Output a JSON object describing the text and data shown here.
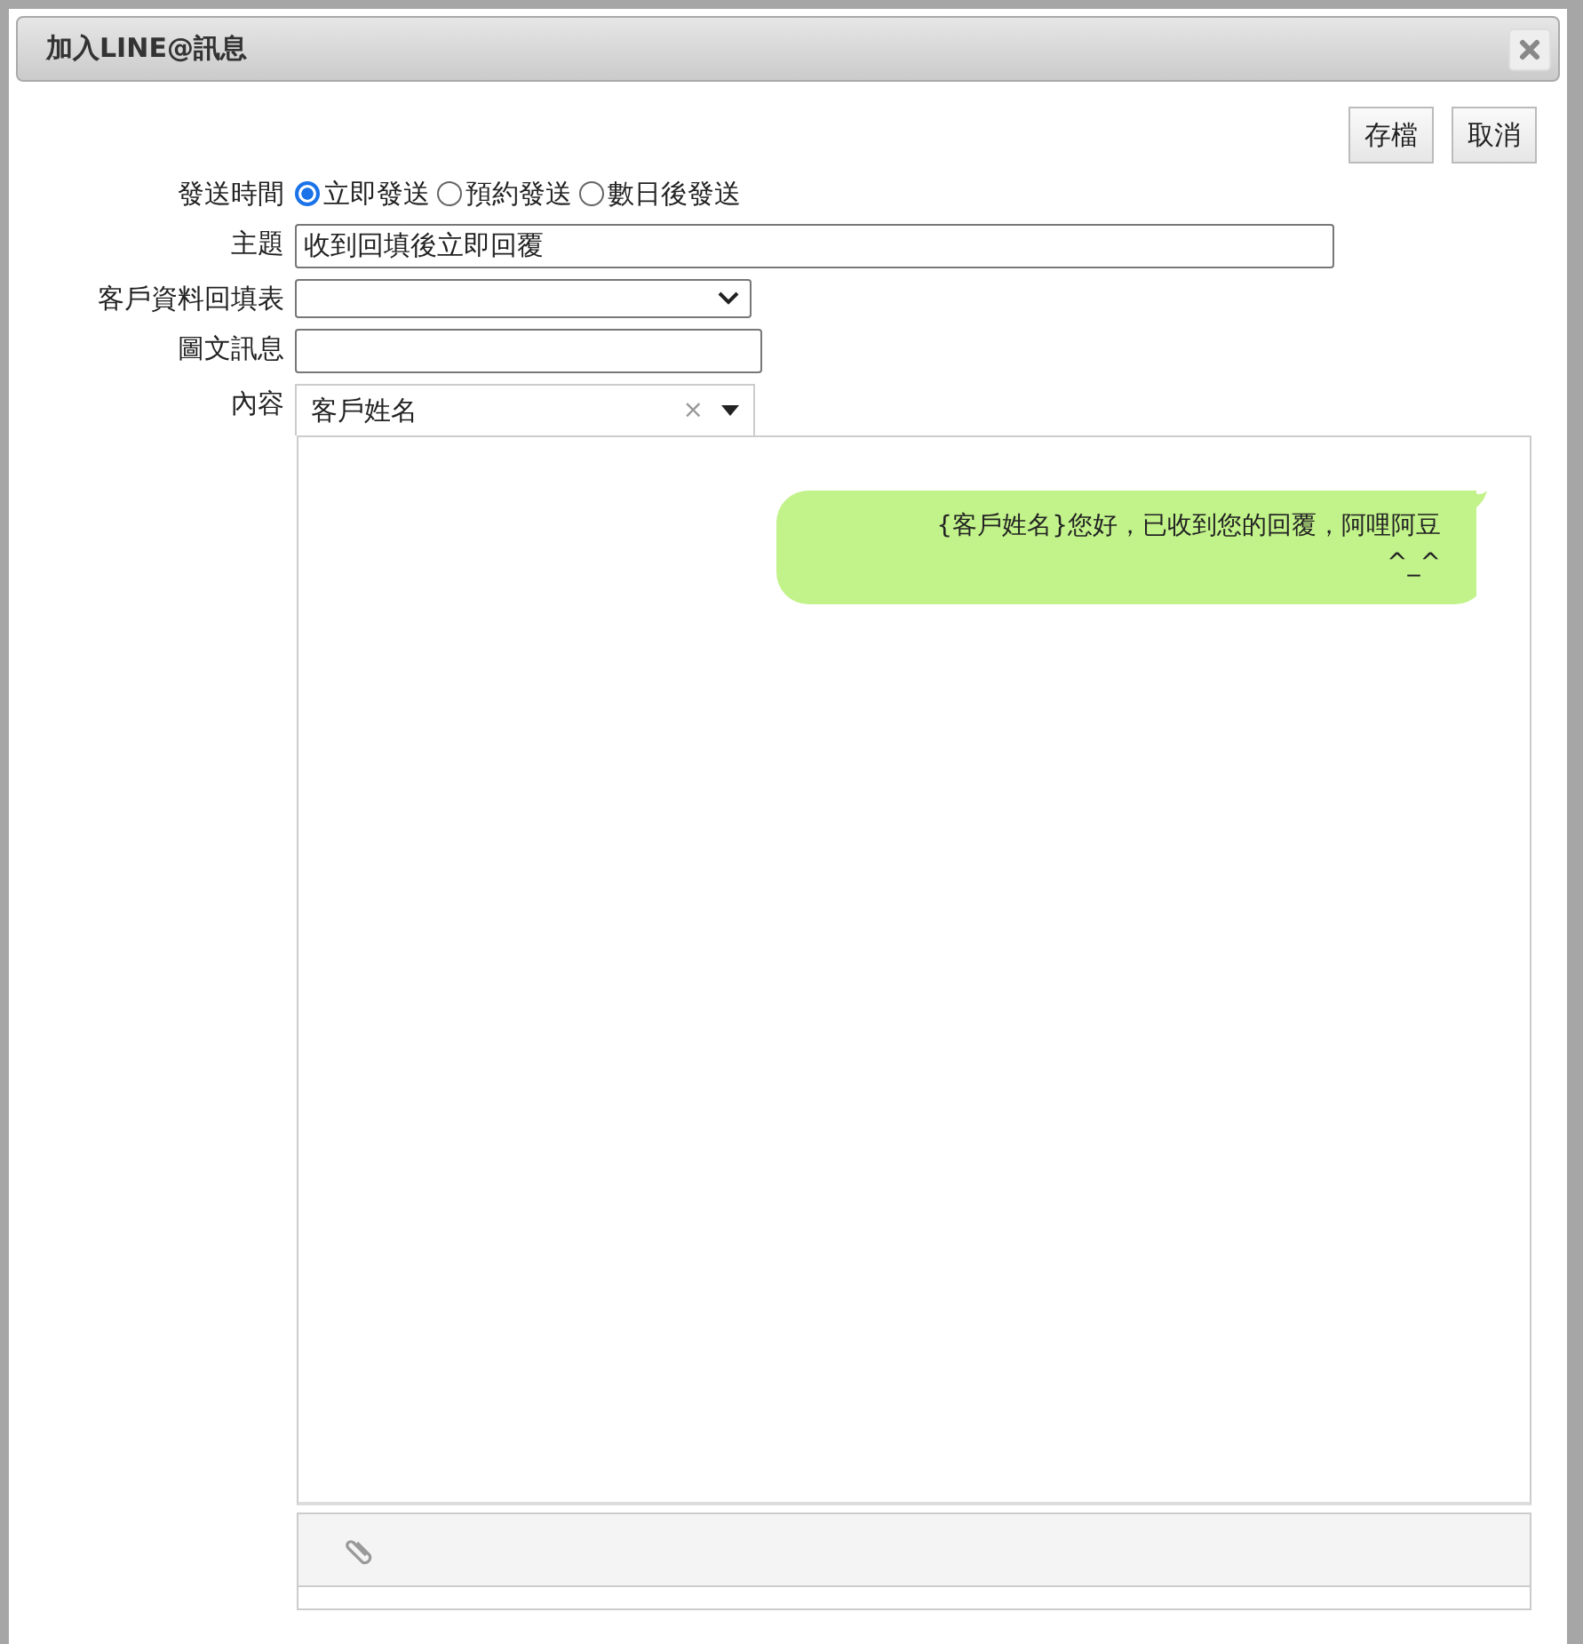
{
  "dialog": {
    "title": "加入LINE@訊息"
  },
  "buttons": [
    "存檔",
    "取消"
  ],
  "send_time": {
    "label": "發送時間",
    "options": [
      {
        "label": "立即發送",
        "selected": true
      },
      {
        "label": "預約發送",
        "selected": false
      },
      {
        "label": "數日後發送",
        "selected": false
      }
    ]
  },
  "subject": {
    "label": "主題",
    "value": "收到回填後立即回覆"
  },
  "form_select": {
    "label": "客戶資料回填表"
  },
  "rich_message": {
    "label": "圖文訊息"
  },
  "content": {
    "label": "內容",
    "tag_select": "客戶姓名",
    "clear": "×"
  },
  "message": {
    "text": "{客戶姓名}您好，已收到您的回覆，阿哩阿豆^_^"
  }
}
